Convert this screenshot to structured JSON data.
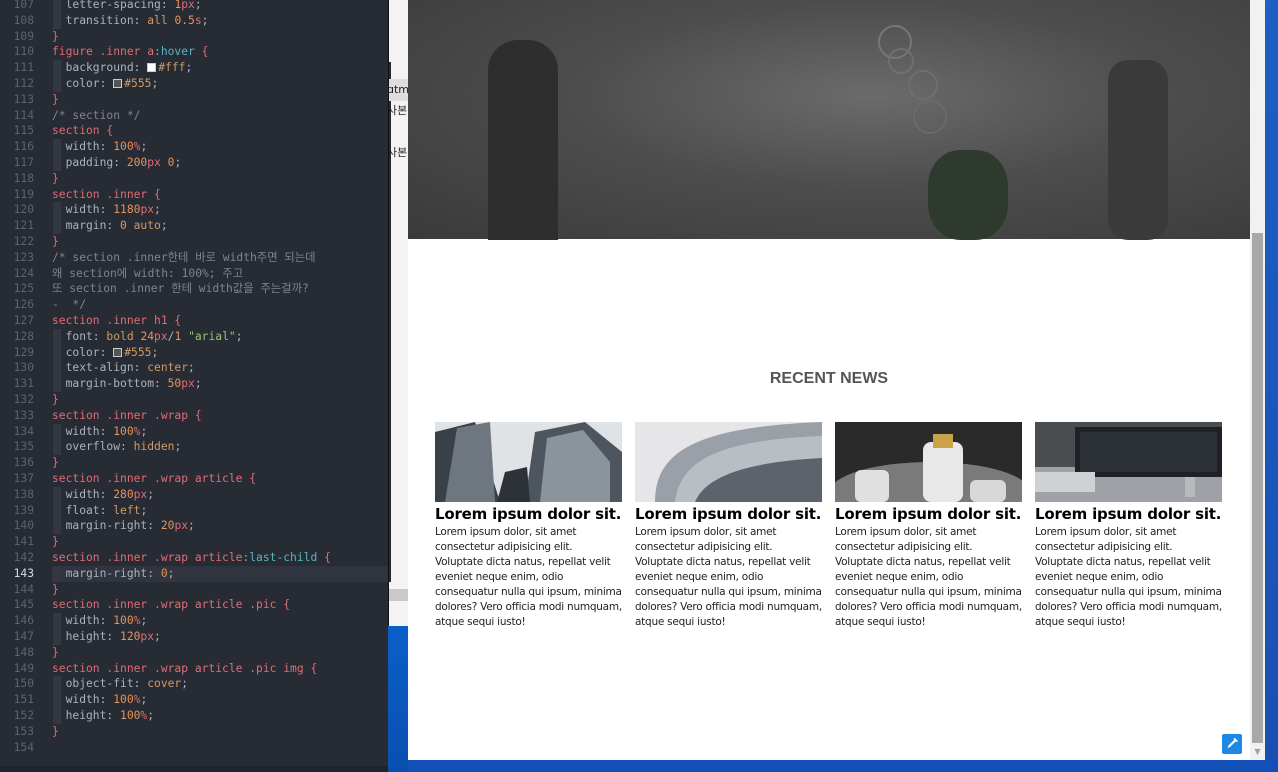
{
  "editor": {
    "active_line": 143,
    "lines": [
      {
        "n": 107,
        "tokens": [
          [
            "g",
            ""
          ],
          [
            "t-prop",
            "  letter-spacing: "
          ],
          [
            "t-num",
            "1"
          ],
          [
            "t-unit",
            "px"
          ],
          [
            "t-prop",
            ";"
          ]
        ]
      },
      {
        "n": 108,
        "tokens": [
          [
            "g",
            ""
          ],
          [
            "t-prop",
            "  transition: "
          ],
          [
            "t-kw",
            "all "
          ],
          [
            "t-num",
            "0.5"
          ],
          [
            "t-unit",
            "s"
          ],
          [
            "t-prop",
            ";"
          ]
        ]
      },
      {
        "n": 109,
        "tokens": [
          [
            "t-brace",
            "}"
          ]
        ]
      },
      {
        "n": 110,
        "tokens": [
          [
            "t-sel",
            "figure .inner a"
          ],
          [
            "t-pseudo",
            ":hover"
          ],
          [
            "t-sel",
            " {"
          ]
        ]
      },
      {
        "n": 111,
        "tokens": [
          [
            "g",
            ""
          ],
          [
            "t-prop",
            "  background: "
          ],
          [
            "sw",
            "#ffffff"
          ],
          [
            "t-kw",
            "#fff"
          ],
          [
            "t-prop",
            ";"
          ]
        ]
      },
      {
        "n": 112,
        "tokens": [
          [
            "g",
            ""
          ],
          [
            "t-prop",
            "  color: "
          ],
          [
            "sw",
            "#555555"
          ],
          [
            "t-kw",
            "#555"
          ],
          [
            "t-prop",
            ";"
          ]
        ]
      },
      {
        "n": 113,
        "tokens": [
          [
            "t-brace",
            "}"
          ]
        ]
      },
      {
        "n": 114,
        "tokens": [
          [
            "t-com",
            "/* section */"
          ]
        ]
      },
      {
        "n": 115,
        "tokens": [
          [
            "t-sel",
            "section {"
          ]
        ]
      },
      {
        "n": 116,
        "tokens": [
          [
            "g",
            ""
          ],
          [
            "t-prop",
            "  width: "
          ],
          [
            "t-num",
            "100"
          ],
          [
            "t-unit",
            "%"
          ],
          [
            "t-prop",
            ";"
          ]
        ]
      },
      {
        "n": 117,
        "tokens": [
          [
            "g",
            ""
          ],
          [
            "t-prop",
            "  padding: "
          ],
          [
            "t-num",
            "200"
          ],
          [
            "t-unit",
            "px "
          ],
          [
            "t-num",
            "0"
          ],
          [
            "t-prop",
            ";"
          ]
        ]
      },
      {
        "n": 118,
        "tokens": [
          [
            "t-brace",
            "}"
          ]
        ]
      },
      {
        "n": 119,
        "tokens": [
          [
            "t-sel",
            "section .inner {"
          ]
        ]
      },
      {
        "n": 120,
        "tokens": [
          [
            "g",
            ""
          ],
          [
            "t-prop",
            "  width: "
          ],
          [
            "t-num",
            "1180"
          ],
          [
            "t-unit",
            "px"
          ],
          [
            "t-prop",
            ";"
          ]
        ]
      },
      {
        "n": 121,
        "tokens": [
          [
            "g",
            ""
          ],
          [
            "t-prop",
            "  margin: "
          ],
          [
            "t-num",
            "0 "
          ],
          [
            "t-kw",
            "auto"
          ],
          [
            "t-prop",
            ";"
          ]
        ]
      },
      {
        "n": 122,
        "tokens": [
          [
            "t-brace",
            "}"
          ]
        ]
      },
      {
        "n": 123,
        "tokens": [
          [
            "t-com",
            "/* section .inner한테 바로 width주면 되는데"
          ]
        ]
      },
      {
        "n": 124,
        "tokens": [
          [
            "t-com",
            "왜 section에 width: 100%; 주고"
          ]
        ]
      },
      {
        "n": 125,
        "tokens": [
          [
            "t-com",
            "또 section .inner 한테 width값을 주는걸까?"
          ]
        ]
      },
      {
        "n": 126,
        "tokens": [
          [
            "t-com",
            "-  */"
          ]
        ]
      },
      {
        "n": 127,
        "tokens": [
          [
            "t-sel",
            "section .inner h1 {"
          ]
        ]
      },
      {
        "n": 128,
        "tokens": [
          [
            "g",
            ""
          ],
          [
            "t-prop",
            "  font: "
          ],
          [
            "t-kw",
            "bold "
          ],
          [
            "t-num",
            "24"
          ],
          [
            "t-unit",
            "px"
          ],
          [
            "t-prop",
            "/"
          ],
          [
            "t-num",
            "1 "
          ],
          [
            "t-str",
            "\"arial\""
          ],
          [
            "t-prop",
            ";"
          ]
        ]
      },
      {
        "n": 129,
        "tokens": [
          [
            "g",
            ""
          ],
          [
            "t-prop",
            "  color: "
          ],
          [
            "sw",
            "#555555"
          ],
          [
            "t-kw",
            "#555"
          ],
          [
            "t-prop",
            ";"
          ]
        ]
      },
      {
        "n": 130,
        "tokens": [
          [
            "g",
            ""
          ],
          [
            "t-prop",
            "  text-align: "
          ],
          [
            "t-kw",
            "center"
          ],
          [
            "t-prop",
            ";"
          ]
        ]
      },
      {
        "n": 131,
        "tokens": [
          [
            "g",
            ""
          ],
          [
            "t-prop",
            "  margin-bottom: "
          ],
          [
            "t-num",
            "50"
          ],
          [
            "t-unit",
            "px"
          ],
          [
            "t-prop",
            ";"
          ]
        ]
      },
      {
        "n": 132,
        "tokens": [
          [
            "t-brace",
            "}"
          ]
        ]
      },
      {
        "n": 133,
        "tokens": [
          [
            "t-sel",
            "section .inner .wrap {"
          ]
        ]
      },
      {
        "n": 134,
        "tokens": [
          [
            "g",
            ""
          ],
          [
            "t-prop",
            "  width: "
          ],
          [
            "t-num",
            "100"
          ],
          [
            "t-unit",
            "%"
          ],
          [
            "t-prop",
            ";"
          ]
        ]
      },
      {
        "n": 135,
        "tokens": [
          [
            "g",
            ""
          ],
          [
            "t-prop",
            "  overflow: "
          ],
          [
            "t-kw",
            "hidden"
          ],
          [
            "t-prop",
            ";"
          ]
        ]
      },
      {
        "n": 136,
        "tokens": [
          [
            "t-brace",
            "}"
          ]
        ]
      },
      {
        "n": 137,
        "tokens": [
          [
            "t-sel",
            "section .inner .wrap article {"
          ]
        ]
      },
      {
        "n": 138,
        "tokens": [
          [
            "g",
            ""
          ],
          [
            "t-prop",
            "  width: "
          ],
          [
            "t-num",
            "280"
          ],
          [
            "t-unit",
            "px"
          ],
          [
            "t-prop",
            ";"
          ]
        ]
      },
      {
        "n": 139,
        "tokens": [
          [
            "g",
            ""
          ],
          [
            "t-prop",
            "  float: "
          ],
          [
            "t-kw",
            "left"
          ],
          [
            "t-prop",
            ";"
          ]
        ]
      },
      {
        "n": 140,
        "tokens": [
          [
            "g",
            ""
          ],
          [
            "t-prop",
            "  margin-right: "
          ],
          [
            "t-num",
            "20"
          ],
          [
            "t-unit",
            "px"
          ],
          [
            "t-prop",
            ";"
          ]
        ]
      },
      {
        "n": 141,
        "tokens": [
          [
            "t-brace",
            "}"
          ]
        ]
      },
      {
        "n": 142,
        "tokens": [
          [
            "t-sel",
            "section .inner .wrap article"
          ],
          [
            "t-pseudo",
            ":last-child"
          ],
          [
            "t-sel",
            " {"
          ]
        ]
      },
      {
        "n": 143,
        "tokens": [
          [
            "g",
            ""
          ],
          [
            "t-prop",
            "  margin-right: "
          ],
          [
            "t-num",
            "0"
          ],
          [
            "t-prop",
            ";"
          ]
        ]
      },
      {
        "n": 144,
        "tokens": [
          [
            "t-brace",
            "}"
          ]
        ]
      },
      {
        "n": 145,
        "tokens": [
          [
            "t-sel",
            "section .inner .wrap article .pic {"
          ]
        ]
      },
      {
        "n": 146,
        "tokens": [
          [
            "g",
            ""
          ],
          [
            "t-prop",
            "  width: "
          ],
          [
            "t-num",
            "100"
          ],
          [
            "t-unit",
            "%"
          ],
          [
            "t-prop",
            ";"
          ]
        ]
      },
      {
        "n": 147,
        "tokens": [
          [
            "g",
            ""
          ],
          [
            "t-prop",
            "  height: "
          ],
          [
            "t-num",
            "120"
          ],
          [
            "t-unit",
            "px"
          ],
          [
            "t-prop",
            ";"
          ]
        ]
      },
      {
        "n": 148,
        "tokens": [
          [
            "t-brace",
            "}"
          ]
        ]
      },
      {
        "n": 149,
        "tokens": [
          [
            "t-sel",
            "section .inner .wrap article .pic img {"
          ]
        ]
      },
      {
        "n": 150,
        "tokens": [
          [
            "g",
            ""
          ],
          [
            "t-prop",
            "  object-fit: "
          ],
          [
            "t-kw",
            "cover"
          ],
          [
            "t-prop",
            ";"
          ]
        ]
      },
      {
        "n": 151,
        "tokens": [
          [
            "g",
            ""
          ],
          [
            "t-prop",
            "  width: "
          ],
          [
            "t-num",
            "100"
          ],
          [
            "t-unit",
            "%"
          ],
          [
            "t-prop",
            ";"
          ]
        ]
      },
      {
        "n": 152,
        "tokens": [
          [
            "g",
            ""
          ],
          [
            "t-prop",
            "  height: "
          ],
          [
            "t-num",
            "100"
          ],
          [
            "t-unit",
            "%"
          ],
          [
            "t-prop",
            ";"
          ]
        ]
      },
      {
        "n": 153,
        "tokens": [
          [
            "t-brace",
            "}"
          ]
        ]
      },
      {
        "n": 154,
        "tokens": []
      }
    ]
  },
  "behind_window": {
    "fragments": [
      "ɑtml",
      "사본",
      "사본."
    ]
  },
  "page": {
    "section_title": "RECENT NEWS",
    "articles": [
      {
        "title": "Lorem ipsum dolor sit.",
        "pic": "buildings",
        "text": "Lorem ipsum dolor, sit amet consectetur adipisicing elit. Voluptate dicta natus, repellat velit eveniet neque enim, odio consequatur nulla qui ipsum, minima dolores? Vero officia modi numquam, atque sequi iusto!"
      },
      {
        "title": "Lorem ipsum dolor sit.",
        "pic": "facade",
        "text": "Lorem ipsum dolor, sit amet consectetur adipisicing elit. Voluptate dicta natus, repellat velit eveniet neque enim, odio consequatur nulla qui ipsum, minima dolores? Vero officia modi numquam, atque sequi iusto!"
      },
      {
        "title": "Lorem ipsum dolor sit.",
        "pic": "bottles",
        "text": "Lorem ipsum dolor, sit amet consectetur adipisicing elit. Voluptate dicta natus, repellat velit eveniet neque enim, odio consequatur nulla qui ipsum, minima dolores? Vero officia modi numquam, atque sequi iusto!"
      },
      {
        "title": "Lorem ipsum dolor sit.",
        "pic": "desk",
        "text": "Lorem ipsum dolor, sit amet consectetur adipisicing elit. Voluptate dicta natus, repellat velit eveniet neque enim, odio consequatur nulla qui ipsum, minima dolores? Vero officia modi numquam, atque sequi iusto!"
      }
    ]
  },
  "icons": {
    "color_picker": "eyedropper-icon",
    "scroll_down": "scroll-down-arrow-icon"
  },
  "colors": {
    "editor_bg": "#272b33",
    "page_bg": "#ffffff",
    "section_title": "#555555",
    "accent": "#1e88e5"
  }
}
